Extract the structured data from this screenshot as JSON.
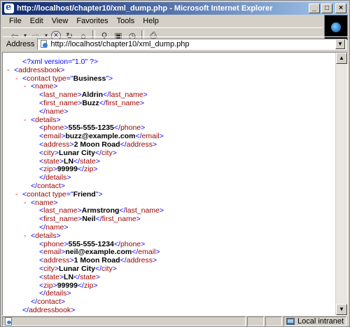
{
  "window": {
    "title": "http://localhost/chapter10/xml_dump.php - Microsoft Internet Explorer"
  },
  "menu": [
    "File",
    "Edit",
    "View",
    "Favorites",
    "Tools",
    "Help"
  ],
  "address": {
    "label": "Address",
    "url": "http://localhost/chapter10/xml_dump.php"
  },
  "xml_lines": [
    {
      "indent": 1,
      "toggle": "",
      "parts": [
        [
          "pi",
          "<?xml version=\"1.0\" ?>"
        ]
      ]
    },
    {
      "indent": 0,
      "toggle": "-",
      "parts": [
        [
          "br",
          "<"
        ],
        [
          "tg",
          "addressbook"
        ],
        [
          "br",
          ">"
        ]
      ]
    },
    {
      "indent": 1,
      "toggle": "-",
      "parts": [
        [
          "br",
          "<"
        ],
        [
          "tg",
          "contact"
        ],
        [
          "at",
          " type"
        ],
        [
          "br",
          "=\""
        ],
        [
          "tx",
          "Business"
        ],
        [
          "br",
          "\">"
        ]
      ]
    },
    {
      "indent": 2,
      "toggle": "-",
      "parts": [
        [
          "br",
          "<"
        ],
        [
          "tg",
          "name"
        ],
        [
          "br",
          ">"
        ]
      ]
    },
    {
      "indent": 3,
      "toggle": "",
      "parts": [
        [
          "br",
          "<"
        ],
        [
          "tg",
          "last_name"
        ],
        [
          "br",
          ">"
        ],
        [
          "tx",
          "Aldrin"
        ],
        [
          "br",
          "</"
        ],
        [
          "tg",
          "last_name"
        ],
        [
          "br",
          ">"
        ]
      ]
    },
    {
      "indent": 3,
      "toggle": "",
      "parts": [
        [
          "br",
          "<"
        ],
        [
          "tg",
          "first_name"
        ],
        [
          "br",
          ">"
        ],
        [
          "tx",
          "Buzz"
        ],
        [
          "br",
          "</"
        ],
        [
          "tg",
          "first_name"
        ],
        [
          "br",
          ">"
        ]
      ]
    },
    {
      "indent": 3,
      "toggle": "",
      "parts": [
        [
          "br",
          "</"
        ],
        [
          "tg",
          "name"
        ],
        [
          "br",
          ">"
        ]
      ]
    },
    {
      "indent": 2,
      "toggle": "-",
      "parts": [
        [
          "br",
          "<"
        ],
        [
          "tg",
          "details"
        ],
        [
          "br",
          ">"
        ]
      ]
    },
    {
      "indent": 3,
      "toggle": "",
      "parts": [
        [
          "br",
          "<"
        ],
        [
          "tg",
          "phone"
        ],
        [
          "br",
          ">"
        ],
        [
          "tx",
          "555-555-1235"
        ],
        [
          "br",
          "</"
        ],
        [
          "tg",
          "phone"
        ],
        [
          "br",
          ">"
        ]
      ]
    },
    {
      "indent": 3,
      "toggle": "",
      "parts": [
        [
          "br",
          "<"
        ],
        [
          "tg",
          "email"
        ],
        [
          "br",
          ">"
        ],
        [
          "tx",
          "buzz@example.com"
        ],
        [
          "br",
          "</"
        ],
        [
          "tg",
          "email"
        ],
        [
          "br",
          ">"
        ]
      ]
    },
    {
      "indent": 3,
      "toggle": "",
      "parts": [
        [
          "br",
          "<"
        ],
        [
          "tg",
          "address"
        ],
        [
          "br",
          ">"
        ],
        [
          "tx",
          "2 Moon Road"
        ],
        [
          "br",
          "</"
        ],
        [
          "tg",
          "address"
        ],
        [
          "br",
          ">"
        ]
      ]
    },
    {
      "indent": 3,
      "toggle": "",
      "parts": [
        [
          "br",
          "<"
        ],
        [
          "tg",
          "city"
        ],
        [
          "br",
          ">"
        ],
        [
          "tx",
          "Lunar City"
        ],
        [
          "br",
          "</"
        ],
        [
          "tg",
          "city"
        ],
        [
          "br",
          ">"
        ]
      ]
    },
    {
      "indent": 3,
      "toggle": "",
      "parts": [
        [
          "br",
          "<"
        ],
        [
          "tg",
          "state"
        ],
        [
          "br",
          ">"
        ],
        [
          "tx",
          "LN"
        ],
        [
          "br",
          "</"
        ],
        [
          "tg",
          "state"
        ],
        [
          "br",
          ">"
        ]
      ]
    },
    {
      "indent": 3,
      "toggle": "",
      "parts": [
        [
          "br",
          "<"
        ],
        [
          "tg",
          "zip"
        ],
        [
          "br",
          ">"
        ],
        [
          "tx",
          "99999"
        ],
        [
          "br",
          "</"
        ],
        [
          "tg",
          "zip"
        ],
        [
          "br",
          ">"
        ]
      ]
    },
    {
      "indent": 3,
      "toggle": "",
      "parts": [
        [
          "br",
          "</"
        ],
        [
          "tg",
          "details"
        ],
        [
          "br",
          ">"
        ]
      ]
    },
    {
      "indent": 2,
      "toggle": "",
      "parts": [
        [
          "br",
          "</"
        ],
        [
          "tg",
          "contact"
        ],
        [
          "br",
          ">"
        ]
      ]
    },
    {
      "indent": 1,
      "toggle": "-",
      "parts": [
        [
          "br",
          "<"
        ],
        [
          "tg",
          "contact"
        ],
        [
          "at",
          " type"
        ],
        [
          "br",
          "=\""
        ],
        [
          "tx",
          "Friend"
        ],
        [
          "br",
          "\">"
        ]
      ]
    },
    {
      "indent": 2,
      "toggle": "-",
      "parts": [
        [
          "br",
          "<"
        ],
        [
          "tg",
          "name"
        ],
        [
          "br",
          ">"
        ]
      ]
    },
    {
      "indent": 3,
      "toggle": "",
      "parts": [
        [
          "br",
          "<"
        ],
        [
          "tg",
          "last_name"
        ],
        [
          "br",
          ">"
        ],
        [
          "tx",
          "Armstrong"
        ],
        [
          "br",
          "</"
        ],
        [
          "tg",
          "last_name"
        ],
        [
          "br",
          ">"
        ]
      ]
    },
    {
      "indent": 3,
      "toggle": "",
      "parts": [
        [
          "br",
          "<"
        ],
        [
          "tg",
          "first_name"
        ],
        [
          "br",
          ">"
        ],
        [
          "tx",
          "Neil"
        ],
        [
          "br",
          "</"
        ],
        [
          "tg",
          "first_name"
        ],
        [
          "br",
          ">"
        ]
      ]
    },
    {
      "indent": 3,
      "toggle": "",
      "parts": [
        [
          "br",
          "</"
        ],
        [
          "tg",
          "name"
        ],
        [
          "br",
          ">"
        ]
      ]
    },
    {
      "indent": 2,
      "toggle": "-",
      "parts": [
        [
          "br",
          "<"
        ],
        [
          "tg",
          "details"
        ],
        [
          "br",
          ">"
        ]
      ]
    },
    {
      "indent": 3,
      "toggle": "",
      "parts": [
        [
          "br",
          "<"
        ],
        [
          "tg",
          "phone"
        ],
        [
          "br",
          ">"
        ],
        [
          "tx",
          "555-555-1234"
        ],
        [
          "br",
          "</"
        ],
        [
          "tg",
          "phone"
        ],
        [
          "br",
          ">"
        ]
      ]
    },
    {
      "indent": 3,
      "toggle": "",
      "parts": [
        [
          "br",
          "<"
        ],
        [
          "tg",
          "email"
        ],
        [
          "br",
          ">"
        ],
        [
          "tx",
          "neil@example.com"
        ],
        [
          "br",
          "</"
        ],
        [
          "tg",
          "email"
        ],
        [
          "br",
          ">"
        ]
      ]
    },
    {
      "indent": 3,
      "toggle": "",
      "parts": [
        [
          "br",
          "<"
        ],
        [
          "tg",
          "address"
        ],
        [
          "br",
          ">"
        ],
        [
          "tx",
          "1 Moon Road"
        ],
        [
          "br",
          "</"
        ],
        [
          "tg",
          "address"
        ],
        [
          "br",
          ">"
        ]
      ]
    },
    {
      "indent": 3,
      "toggle": "",
      "parts": [
        [
          "br",
          "<"
        ],
        [
          "tg",
          "city"
        ],
        [
          "br",
          ">"
        ],
        [
          "tx",
          "Lunar City"
        ],
        [
          "br",
          "</"
        ],
        [
          "tg",
          "city"
        ],
        [
          "br",
          ">"
        ]
      ]
    },
    {
      "indent": 3,
      "toggle": "",
      "parts": [
        [
          "br",
          "<"
        ],
        [
          "tg",
          "state"
        ],
        [
          "br",
          ">"
        ],
        [
          "tx",
          "LN"
        ],
        [
          "br",
          "</"
        ],
        [
          "tg",
          "state"
        ],
        [
          "br",
          ">"
        ]
      ]
    },
    {
      "indent": 3,
      "toggle": "",
      "parts": [
        [
          "br",
          "<"
        ],
        [
          "tg",
          "zip"
        ],
        [
          "br",
          ">"
        ],
        [
          "tx",
          "99999"
        ],
        [
          "br",
          "</"
        ],
        [
          "tg",
          "zip"
        ],
        [
          "br",
          ">"
        ]
      ]
    },
    {
      "indent": 3,
      "toggle": "",
      "parts": [
        [
          "br",
          "</"
        ],
        [
          "tg",
          "details"
        ],
        [
          "br",
          ">"
        ]
      ]
    },
    {
      "indent": 2,
      "toggle": "",
      "parts": [
        [
          "br",
          "</"
        ],
        [
          "tg",
          "contact"
        ],
        [
          "br",
          ">"
        ]
      ]
    },
    {
      "indent": 1,
      "toggle": "",
      "parts": [
        [
          "br",
          "</"
        ],
        [
          "tg",
          "addressbook"
        ],
        [
          "br",
          ">"
        ]
      ]
    }
  ],
  "status": {
    "zone": "Local intranet"
  },
  "icons": {
    "back": "back-arrow-icon",
    "forward": "forward-arrow-icon",
    "stop": "stop-icon",
    "refresh": "refresh-icon",
    "home": "home-icon",
    "search": "search-icon",
    "favorites": "favorites-icon",
    "history": "history-icon",
    "print": "printer-icon"
  }
}
